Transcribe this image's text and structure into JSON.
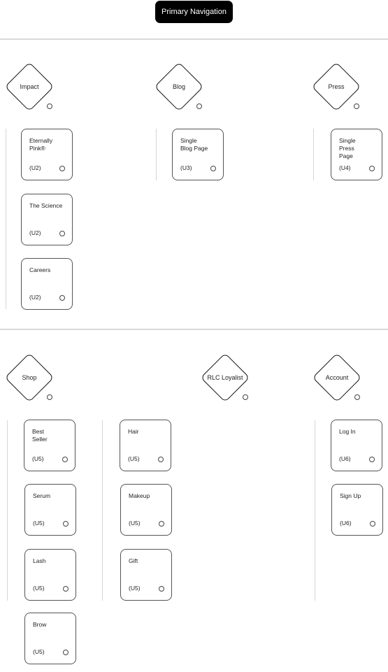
{
  "title": "Primary Navigation",
  "sections": [
    {
      "groups": [
        {
          "label": "Impact",
          "children": [
            {
              "name": "Eternally Pink®",
              "code": "(U2)"
            },
            {
              "name": "The Science",
              "code": "(U2)"
            },
            {
              "name": "Careers",
              "code": "(U2)"
            }
          ]
        },
        {
          "label": "Blog",
          "children": [
            {
              "name": "Single Blog Page",
              "code": "(U3)"
            }
          ]
        },
        {
          "label": "Press",
          "children": [
            {
              "name": "Single Press Page",
              "code": "(U4)"
            }
          ]
        }
      ]
    },
    {
      "groups": [
        {
          "label": "Shop",
          "children": [
            {
              "name": "Best Seller",
              "code": "(U5)"
            },
            {
              "name": "Serum",
              "code": "(U5)"
            },
            {
              "name": "Lash",
              "code": "(U5)"
            },
            {
              "name": "Brow",
              "code": "(U5)"
            },
            {
              "name": "Hair",
              "code": "(U5)"
            },
            {
              "name": "Makeup",
              "code": "(U5)"
            },
            {
              "name": "Gift",
              "code": "(U5)"
            }
          ]
        },
        {
          "label": "RLC Loyalist",
          "children": []
        },
        {
          "label": "Account",
          "children": [
            {
              "name": "Log In",
              "code": "(U6)"
            },
            {
              "name": "Sign Up",
              "code": "(U6)"
            }
          ]
        }
      ]
    }
  ]
}
